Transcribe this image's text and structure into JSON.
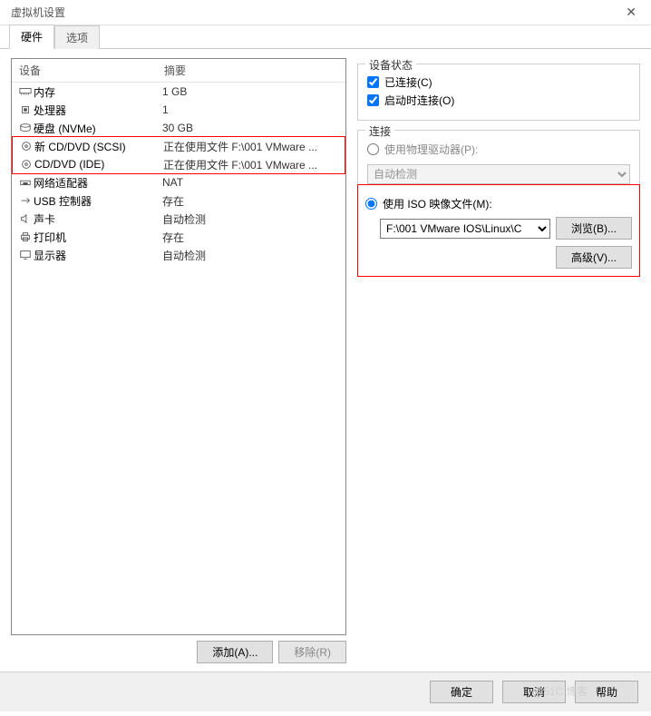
{
  "title": "虚拟机设置",
  "tabs": {
    "hardware": "硬件",
    "options": "选项"
  },
  "device_list": {
    "header": {
      "device": "设备",
      "summary": "摘要"
    },
    "items": [
      {
        "icon": "memory",
        "name": "内存",
        "summary": "1 GB"
      },
      {
        "icon": "cpu",
        "name": "处理器",
        "summary": "1"
      },
      {
        "icon": "disk",
        "name": "硬盘 (NVMe)",
        "summary": "30 GB"
      },
      {
        "icon": "disc",
        "name": "新 CD/DVD (SCSI)",
        "summary": "正在使用文件 F:\\001 VMware ..."
      },
      {
        "icon": "disc",
        "name": "CD/DVD (IDE)",
        "summary": "正在使用文件 F:\\001 VMware ..."
      },
      {
        "icon": "net",
        "name": "网络适配器",
        "summary": "NAT"
      },
      {
        "icon": "usb",
        "name": "USB 控制器",
        "summary": "存在"
      },
      {
        "icon": "sound",
        "name": "声卡",
        "summary": "自动检测"
      },
      {
        "icon": "printer",
        "name": "打印机",
        "summary": "存在"
      },
      {
        "icon": "display",
        "name": "显示器",
        "summary": "自动检测"
      }
    ]
  },
  "buttons": {
    "add": "添加(A)...",
    "remove": "移除(R)"
  },
  "device_state": {
    "legend": "设备状态",
    "connected": "已连接(C)",
    "connect_at_poweron": "启动时连接(O)"
  },
  "connection": {
    "legend": "连接",
    "use_physical": "使用物理驱动器(P):",
    "auto_detect": "自动检测",
    "use_iso": "使用 ISO 映像文件(M):",
    "iso_path": "F:\\001 VMware IOS\\Linux\\C",
    "browse": "浏览(B)...",
    "advanced": "高级(V)..."
  },
  "footer": {
    "ok": "确定",
    "cancel": "取消",
    "help": "帮助"
  },
  "watermark": "@51C 博客"
}
